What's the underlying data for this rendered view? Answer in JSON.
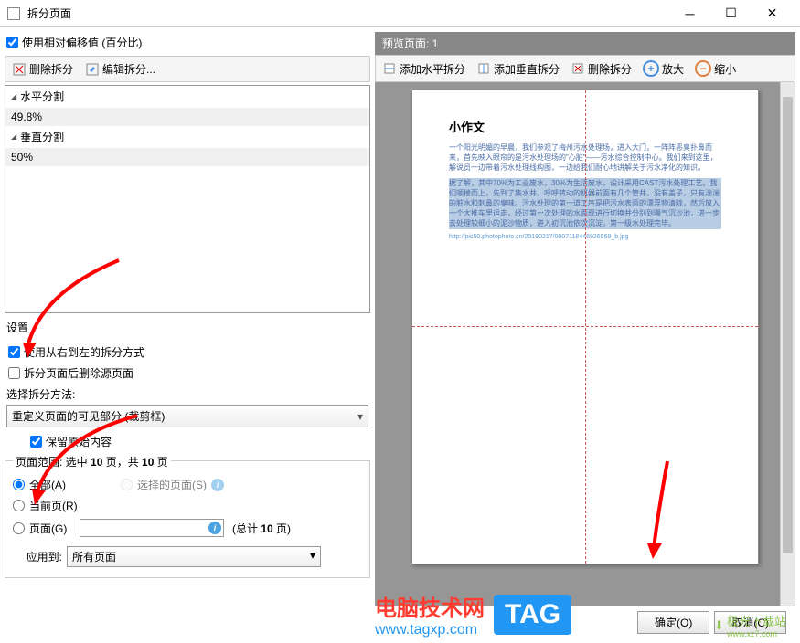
{
  "titlebar": {
    "title": "拆分页面"
  },
  "left": {
    "use_relative": "使用相对偏移值 (百分比)",
    "toolbar": {
      "delete_split": "删除拆分",
      "edit_split": "编辑拆分..."
    },
    "list": {
      "h_header": "水平分割",
      "h_value": "49.8%",
      "v_header": "垂直分割",
      "v_value": "50%"
    },
    "settings": {
      "title": "设置",
      "rtl_split": "使用从右到左的拆分方式",
      "delete_source": "拆分页面后删除源页面",
      "method_label": "选择拆分方法:",
      "method_value": "重定义页面的可见部分 (裁剪框)",
      "keep_original": "保留原始内容"
    },
    "range": {
      "title_prefix": "页面范围: 选中 ",
      "title_mid": " 页，共 ",
      "title_suffix": " 页",
      "count1": "10",
      "count2": "10",
      "all": "全部(A)",
      "selected": "选择的页面(S)",
      "current": "当前页(R)",
      "pages": "页面(G)",
      "total_prefix": "(总计 ",
      "total_count": "10",
      "total_suffix": " 页)",
      "apply_to_label": "应用到:",
      "apply_to_value": "所有页面"
    }
  },
  "right": {
    "preview_header": "预览页面: 1",
    "toolbar": {
      "add_h": "添加水平拆分",
      "add_v": "添加垂直拆分",
      "delete": "删除拆分",
      "zoom_in": "放大",
      "zoom_out": "缩小"
    },
    "doc": {
      "title": "小作文",
      "para1": "一个阳光明媚的早晨，我们参观了梅州污水处理场，进入大门，一阵阵恶臭扑鼻而来，首先映入眼帘的是污水处理场的\"心脏\"——污水综合控制中心。我们来到这里，解说员一边带着污水处理线构图，一边给我们耐心地讲解关于污水净化的知识。",
      "para2": "据了解，其中70%为工业废水，30%为生活废水，设计采用CAST污水处理工艺。我们顺楼而上，先到了集水井，呼呼转动的机器前面有几个管井，没有盖子，只有湍湍的脏水和刺鼻的臭味。污水处理的第一道工序是把污水表面的漂浮物清除，然后放入一个大推车里运走，经过第一次处理的水面现进行切换并分别到曝气沉沙池，进一步去处理较细小的泥沙物质，进入初沉池依次沉淀，第一级水处理完毕。",
      "link": "http://pic50.photophoto.cn/20190217/0007118446926569_b.jpg"
    }
  },
  "footer": {
    "ok": "确定(O)",
    "cancel": "取消(C)"
  },
  "watermark": {
    "text": "电脑技术网",
    "url": "www.tagxp.com",
    "tag": "TAG",
    "download": "极光下载站",
    "download_url": "www.xz7.com"
  }
}
